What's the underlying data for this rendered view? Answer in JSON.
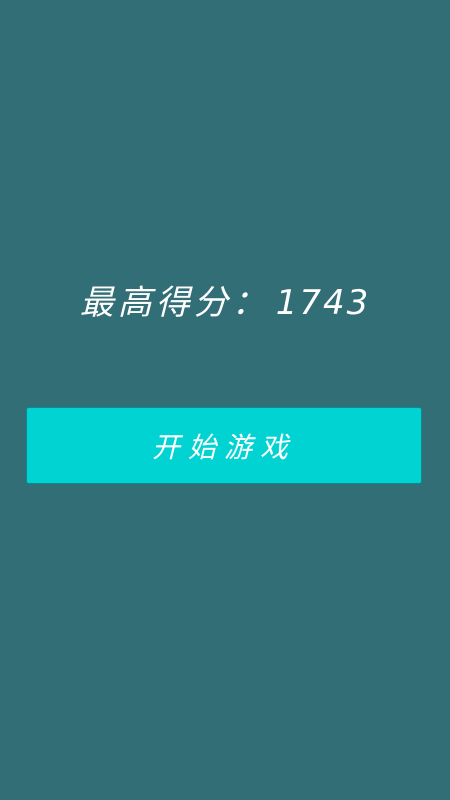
{
  "colors": {
    "background": "#326e76",
    "button": "#01d3d3",
    "text": "#ffffff"
  },
  "high_score": {
    "label": "最高得分：",
    "value": "1743"
  },
  "start_button": {
    "label": "开始游戏"
  }
}
